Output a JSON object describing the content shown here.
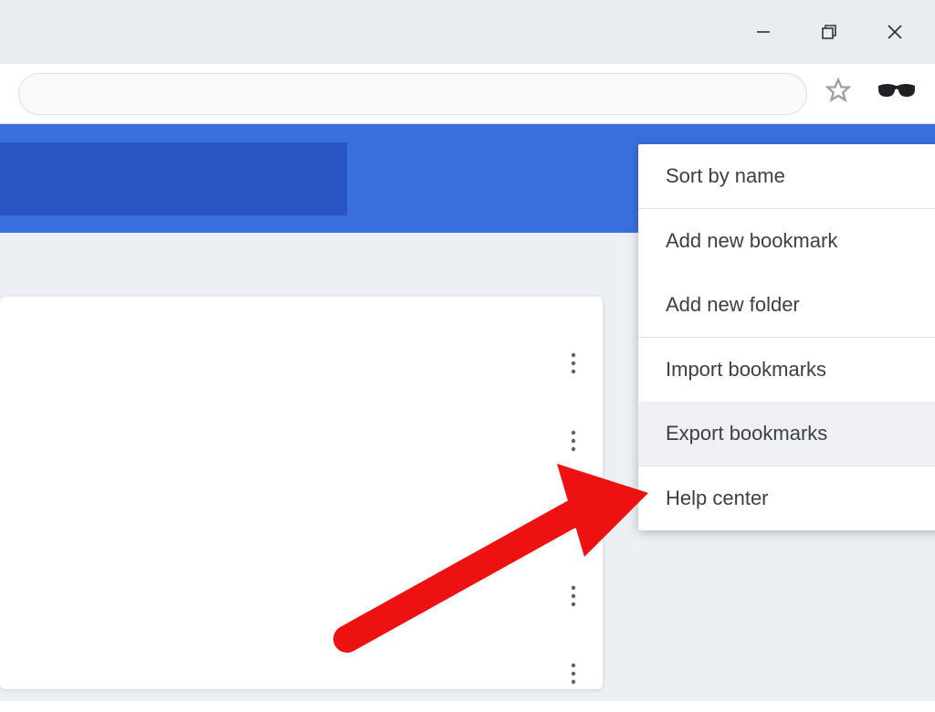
{
  "titlebar": {
    "minimize": "minimize",
    "maximize": "maximize",
    "close": "close"
  },
  "addressbar": {
    "star": "star",
    "extension": "reader-view"
  },
  "menu": {
    "sort_by_name": "Sort by name",
    "add_new_bookmark": "Add new bookmark",
    "add_new_folder": "Add new folder",
    "import_bookmarks": "Import bookmarks",
    "export_bookmarks": "Export bookmarks",
    "help_center": "Help center"
  }
}
